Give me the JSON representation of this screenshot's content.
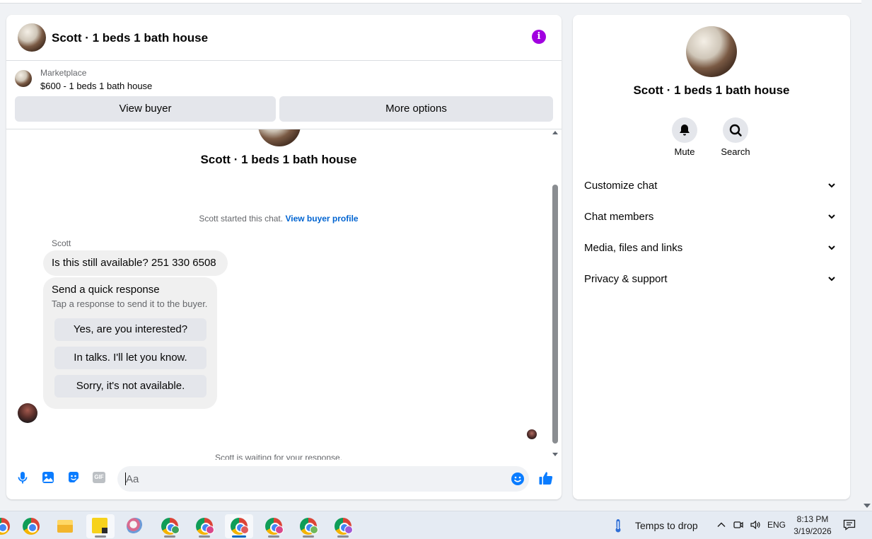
{
  "chat": {
    "title": "Scott · 1 beds 1 bath house",
    "marketplace_label": "Marketplace",
    "listing": "$600 - 1 beds 1 bath house",
    "view_buyer": "View buyer",
    "more_options": "More options",
    "thread_title": "Scott · 1 beds 1 bath house",
    "started_text": "Scott started this chat.",
    "view_buyer_profile": "View buyer profile",
    "sender_name": "Scott",
    "message": "Is this still available? 251 330 6508",
    "quick_title": "Send a quick response",
    "quick_subtitle": "Tap a response to send it to the buyer.",
    "quick_responses": [
      "Yes, are you interested?",
      "In talks. I'll let you know.",
      "Sorry, it's not available."
    ],
    "waiting_text": "Scott is waiting for your response.",
    "input_placeholder": "Aa"
  },
  "side": {
    "title": "Scott · 1 beds 1 bath house",
    "mute_label": "Mute",
    "search_label": "Search",
    "sections": [
      "Customize chat",
      "Chat members",
      "Media, files and links",
      "Privacy & support"
    ]
  },
  "taskbar": {
    "weather": "Temps to drop",
    "language": "ENG",
    "time": "8:13 PM",
    "date": "3/19/2026"
  },
  "colors": {
    "accent": "#0064d1",
    "info": "#a100e0",
    "icon_blue": "#0a7cff"
  }
}
